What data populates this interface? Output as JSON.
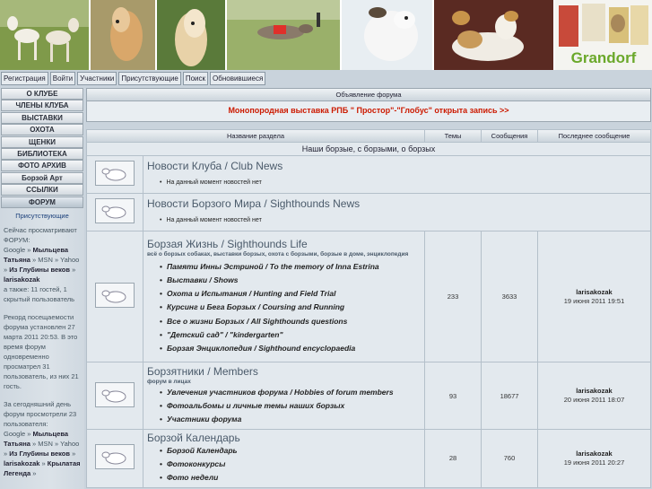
{
  "nav": [
    "Регистрация",
    "Войти",
    "Участники",
    "Присутствующие",
    "Поиск",
    "Обновившиеся"
  ],
  "banner": {
    "logo_text": "Grandorf"
  },
  "menu": [
    "О КЛУБЕ",
    "ЧЛЕНЫ КЛУБА",
    "ВЫСТАВКИ",
    "ОХОТА",
    "ЩЕНКИ",
    "БИБЛИОТЕКА",
    "ФОТО АРХИВ",
    "Борзой Арт",
    "ССЫЛКИ",
    "ФОРУМ"
  ],
  "present_link": "Присутствующие",
  "info": {
    "now_viewing": "Сейчас просматривают ФОРУМ:",
    "google": "Google",
    "user1": "Мыльцева Татьяна",
    "msn": "MSN",
    "yahoo": "Yahoo",
    "user2": "Из Глубины веков",
    "user3": "larisakozak",
    "also": "а также: 11 гостей, 1 скрытый пользователь",
    "record": "Рекорд посещаемости форума установлен 27 марта 2011 20:53. В это время форум одновременно просматрел 31 пользователь, из них 21 гость.",
    "today": "За сегодняшний день форум просмотрели 23 пользователя:",
    "user4": "Крылатая Легенда"
  },
  "announcement": {
    "header": "Объявление форума",
    "text": "Монопородная выставка РПБ \" Простор\"-\"Глобус\" открыта запись >>"
  },
  "table": {
    "headers": [
      "Название раздела",
      "Темы",
      "Сообщения",
      "Последнее сообщение"
    ],
    "category": "Наши борзые, с борзыми, о борзых",
    "forums": [
      {
        "title": "Новости Клуба / Club News",
        "desc": "",
        "subs": [
          "На данный момент новостей нет"
        ],
        "topics": "",
        "posts": "",
        "last_user": "",
        "last_date": ""
      },
      {
        "title": "Новости Борзого Мира / Sighthounds News",
        "desc": "",
        "subs": [
          "На данный момент новостей нет"
        ],
        "topics": "",
        "posts": "",
        "last_user": "",
        "last_date": ""
      },
      {
        "title": "Борзая Жизнь / Sighthounds Life",
        "desc": "всё о борзых собаках, выставки борзых, охота с борзыми, борзые в доме, энциклопедия",
        "subs": [
          "Памяти Инны Эстриной / To the memory of Inna Estrina",
          "Выставки / Shows",
          "Охота и Испытания / Hunting and Field Trial",
          "Курсинг и Бега Борзых / Coursing and Running",
          "Все о жизни Борзых / All Sighthounds questions",
          "\"Детский сад\" / \"kindergarten\"",
          "Борзая Энциклопедия / Sighthound encyclopaedia"
        ],
        "topics": "233",
        "posts": "3633",
        "last_user": "larisakozak",
        "last_date": "19 июня 2011 19:51"
      },
      {
        "title": "Борзятники / Members",
        "desc": "форум в лицах",
        "subs": [
          "Увлечения участников форума / Hobbies of forum members",
          "Фотоальбомы и личные темы наших борзых",
          "Участники форума"
        ],
        "topics": "93",
        "posts": "18677",
        "last_user": "larisakozak",
        "last_date": "20 июня 2011 18:07"
      },
      {
        "title": "Борзой Календарь",
        "desc": "",
        "subs": [
          "Борзой Календарь",
          "Фотоконкурсы",
          "Фото недели"
        ],
        "topics": "28",
        "posts": "760",
        "last_user": "larisakozak",
        "last_date": "19 июня 2011 20:27"
      }
    ]
  }
}
